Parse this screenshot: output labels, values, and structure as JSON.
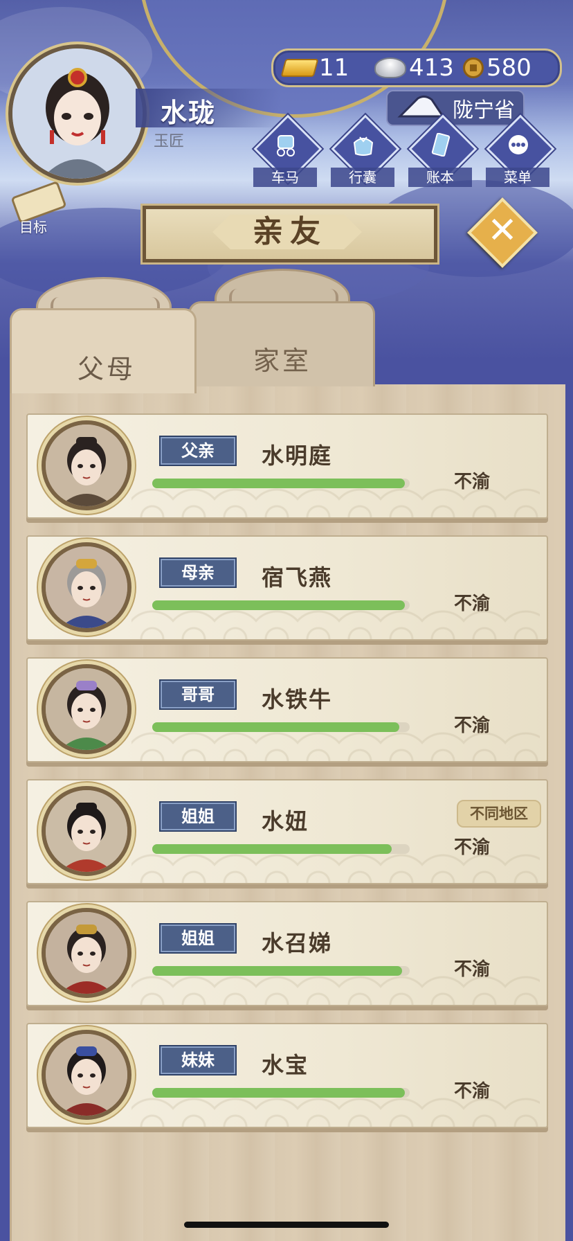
{
  "player": {
    "name": "水珑",
    "occupation": "玉匠"
  },
  "currency": {
    "gold": "11",
    "silver": "413",
    "coin": "580"
  },
  "province": "陇宁省",
  "menu": [
    {
      "label": "车马",
      "icon": "carriage-icon"
    },
    {
      "label": "行囊",
      "icon": "bundle-icon"
    },
    {
      "label": "账本",
      "icon": "ledger-icon"
    },
    {
      "label": "菜单",
      "icon": "more-icon"
    }
  ],
  "goal_label": "目标",
  "panel_title": "亲友",
  "tabs": [
    {
      "label": "父母",
      "active": true
    },
    {
      "label": "家室",
      "active": false
    }
  ],
  "members": [
    {
      "relation": "父亲",
      "name": "水明庭",
      "mood": "不渝",
      "mood_level": 0.98,
      "region": ""
    },
    {
      "relation": "母亲",
      "name": "宿飞燕",
      "mood": "不渝",
      "mood_level": 0.98,
      "region": ""
    },
    {
      "relation": "哥哥",
      "name": "水铁牛",
      "mood": "不渝",
      "mood_level": 0.96,
      "region": ""
    },
    {
      "relation": "姐姐",
      "name": "水妞",
      "mood": "不渝",
      "mood_level": 0.93,
      "region": "不同地区"
    },
    {
      "relation": "姐姐",
      "name": "水召娣",
      "mood": "不渝",
      "mood_level": 0.97,
      "region": ""
    },
    {
      "relation": "妹妹",
      "name": "水宝",
      "mood": "不渝",
      "mood_level": 0.98,
      "region": ""
    }
  ],
  "colors": {
    "accent": "#4c6088",
    "bar": "#7cbf5a",
    "panel": "#d9c9b0"
  }
}
